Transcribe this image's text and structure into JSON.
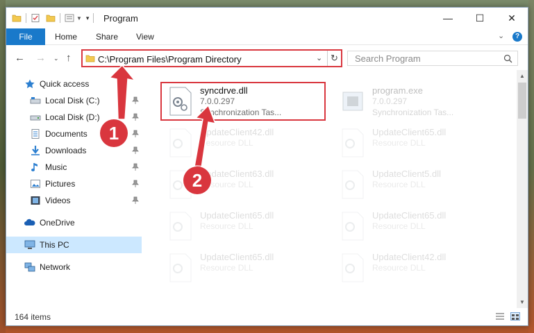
{
  "window": {
    "title": "Program",
    "controls": {
      "minimize": "—",
      "maximize": "☐",
      "close": "✕"
    }
  },
  "ribbon": {
    "tabs": [
      {
        "label": "File"
      },
      {
        "label": "Home"
      },
      {
        "label": "Share"
      },
      {
        "label": "View"
      }
    ],
    "help": "?"
  },
  "address_bar": {
    "path": "C:\\Program Files\\Program Directory",
    "search_placeholder": "Search Program"
  },
  "sidebar": {
    "items": [
      {
        "label": "Quick access",
        "icon": "star-icon",
        "pinned": false
      },
      {
        "label": "Local Disk (C:)",
        "icon": "drive-icon",
        "pinned": true
      },
      {
        "label": "Local Disk (D:)",
        "icon": "drive-icon",
        "pinned": true
      },
      {
        "label": "Documents",
        "icon": "documents-icon",
        "pinned": true
      },
      {
        "label": "Downloads",
        "icon": "download-icon",
        "pinned": true
      },
      {
        "label": "Music",
        "icon": "music-icon",
        "pinned": true
      },
      {
        "label": "Pictures",
        "icon": "pictures-icon",
        "pinned": true
      },
      {
        "label": "Videos",
        "icon": "videos-icon",
        "pinned": true
      },
      {
        "label": "OneDrive",
        "icon": "cloud-icon",
        "pinned": false
      },
      {
        "label": "This PC",
        "icon": "computer-icon",
        "pinned": false,
        "selected": true
      },
      {
        "label": "Network",
        "icon": "network-icon",
        "pinned": false
      }
    ]
  },
  "files": [
    {
      "name": "syncdrve.dll",
      "version": "7.0.0.297",
      "description": "Synchronization Tas...",
      "highlighted": true
    },
    {
      "name": "program.exe",
      "version": "7.0.0.297",
      "description": "Synchronization Tas..."
    },
    {
      "name": "UpdateClient42.dll",
      "description": "Resource DLL"
    },
    {
      "name": "UpdateClient65.dll",
      "description": "Resource DLL"
    },
    {
      "name": "UpdateClient63.dll",
      "description": "Resource DLL"
    },
    {
      "name": "UpdateClient5.dll",
      "description": "Resource DLL"
    },
    {
      "name": "UpdateClient65.dll",
      "description": "Resource DLL"
    },
    {
      "name": "UpdateClient65.dll",
      "description": "Resource DLL"
    },
    {
      "name": "UpdateClient65.dll",
      "description": "Resource DLL"
    },
    {
      "name": "UpdateClient42.dll",
      "description": "Resource DLL"
    }
  ],
  "status": {
    "item_count": "164 items"
  },
  "annotations": {
    "step1": "1",
    "step2": "2"
  },
  "colors": {
    "accent": "#1979ca",
    "highlight": "#d9363e",
    "selected": "#cce8ff"
  }
}
